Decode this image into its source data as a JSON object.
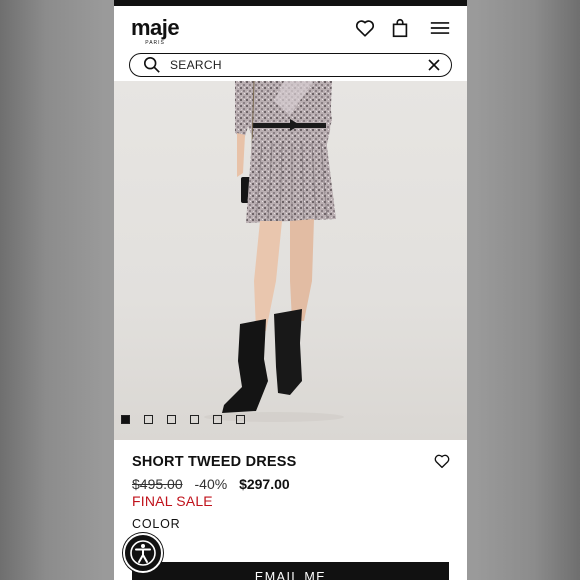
{
  "brand": {
    "name": "maje",
    "sub": "PARIS"
  },
  "header_icons": [
    "heart-icon",
    "shopping-bag-icon",
    "menu-icon"
  ],
  "search": {
    "placeholder": "SEARCH"
  },
  "gallery": {
    "slides": 6,
    "active_index": 0
  },
  "product": {
    "title": "SHORT TWEED DRESS",
    "original_price": "$495.00",
    "discount": "-40%",
    "sale_price": "$297.00",
    "final_sale": "FINAL SALE",
    "color_label": "COLOR"
  },
  "cta": {
    "label": "EMAIL ME"
  },
  "colors": {
    "sale_red": "#c0121b",
    "ink": "#111111"
  }
}
